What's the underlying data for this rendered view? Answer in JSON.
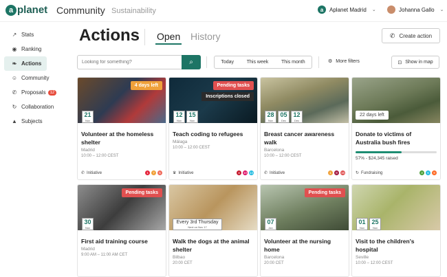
{
  "header": {
    "logo_mark": "a",
    "logo_text": "planet",
    "product": "Community",
    "section": "Sustainability",
    "org_mark": "a",
    "org_name": "Aplanet Madrid",
    "user_name": "Johanna Gallo"
  },
  "sidebar": {
    "items": [
      {
        "label": "Stats",
        "icon": "trend-icon"
      },
      {
        "label": "Ranking",
        "icon": "eye-icon"
      },
      {
        "label": "Actions",
        "icon": "leaf-icon"
      },
      {
        "label": "Community",
        "icon": "people-icon"
      },
      {
        "label": "Proposals",
        "icon": "megaphone-icon",
        "badge": "12"
      },
      {
        "label": "Collaboration",
        "icon": "cycle-icon"
      },
      {
        "label": "Subjects",
        "icon": "graduation-icon"
      }
    ]
  },
  "page": {
    "title": "Actions",
    "tab_open": "Open",
    "tab_history": "History",
    "create_label": "Create action"
  },
  "filters": {
    "search_placeholder": "Looking for something?",
    "today": "Today",
    "this_week": "This week",
    "this_month": "This month",
    "more_filters": "More filters",
    "show_in_map": "Show in map"
  },
  "colors": {
    "brand": "#1d7565",
    "tag_orange": "#f0a13a",
    "tag_red": "#e05050"
  },
  "cards": [
    {
      "tag": "4 days left",
      "dates": [
        {
          "d": "21",
          "m": "Nov"
        }
      ],
      "title": "Volunteer at the homeless shelter",
      "city": "Madrid",
      "time": "10:00 – 12:00 CEST",
      "type": "Initiative",
      "dots": [
        "1",
        "7",
        "5"
      ]
    },
    {
      "tag": "Pending tasks",
      "subtag": "Inscriptions closed",
      "dates": [
        {
          "d": "12",
          "m": "Nov"
        },
        {
          "d": "15",
          "m": "Nov"
        }
      ],
      "title": "Teach coding to refugees",
      "city": "Málaga",
      "time": "10:00 – 12:00 CEST",
      "type": "Initiative",
      "dots": [
        "4",
        "10",
        "14"
      ]
    },
    {
      "dates": [
        {
          "d": "28",
          "m": "Nov"
        },
        {
          "d": "05",
          "m": "Dec"
        },
        {
          "d": "12",
          "m": "Dec"
        }
      ],
      "title": "Breast cancer awareness walk",
      "city": "Barcelona",
      "time": "10:00 – 12:00 CEST",
      "type": "Initiative",
      "dots": [
        "1",
        "8",
        "16"
      ]
    },
    {
      "tag_gray": "22 days left",
      "title": "Donate to victims of Australia bush fires",
      "progress": 0.57,
      "raised": "57% - $24,345 raised",
      "type": "Fundraising",
      "dots": [
        "3",
        "6",
        "9"
      ]
    },
    {
      "tag": "Pending tasks",
      "dates": [
        {
          "d": "30",
          "m": "Nov"
        }
      ],
      "title": "First aid training course",
      "city": "Madrid",
      "time": "9:00 AM – 11:00 AM CET"
    },
    {
      "note_line1": "Every 3rd Thursday",
      "note_line2": "Next on Nov 17",
      "title": "Walk the dogs at the animal shelter",
      "city": "Bilbao",
      "time": "20:00 CET"
    },
    {
      "tag": "Pending tasks",
      "dates": [
        {
          "d": "07",
          "m": "Jan"
        }
      ],
      "title": "Volunteer at the nursing home",
      "city": "Barcelona",
      "time": "20:00 CET"
    },
    {
      "dates": [
        {
          "d": "01",
          "m": "Nov"
        },
        {
          "d": "25",
          "m": "Nov"
        }
      ],
      "title": "Visit to the children's hospital",
      "city": "Seville",
      "time": "10:00 – 12:00 CEST"
    }
  ]
}
